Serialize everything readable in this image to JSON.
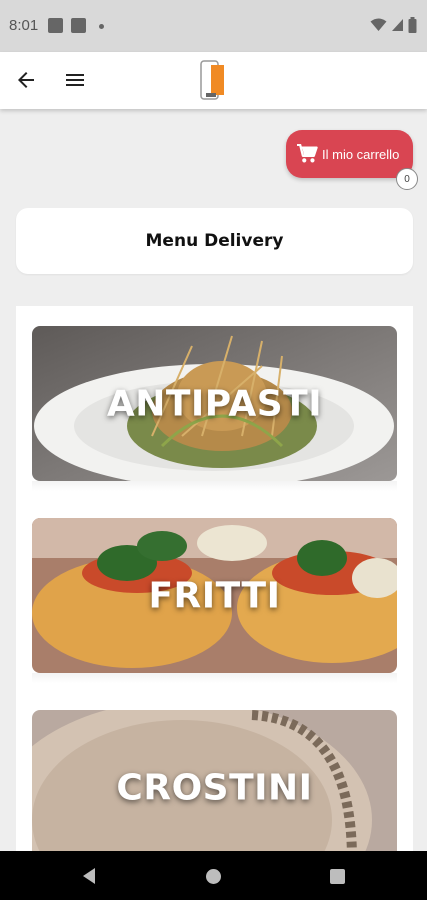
{
  "status_bar": {
    "time": "8:01"
  },
  "header": {
    "back_icon": "arrow-left-icon",
    "menu_icon": "hamburger-menu-icon",
    "logo_icon": "app-logo"
  },
  "cart": {
    "label": "Il mio carrello",
    "count": "0",
    "color": "#d94552",
    "icon": "cart-icon"
  },
  "page": {
    "title": "Menu Delivery"
  },
  "categories": [
    {
      "label": "ANTIPASTI"
    },
    {
      "label": "FRITTI"
    },
    {
      "label": "CROSTINI"
    }
  ]
}
